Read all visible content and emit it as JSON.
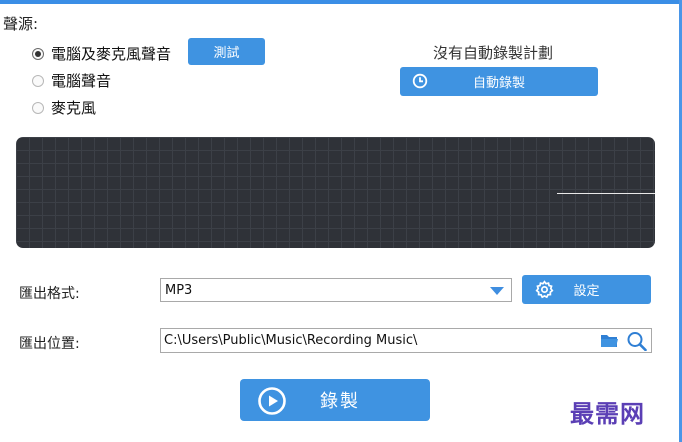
{
  "colors": {
    "accent": "#3f93e1",
    "window_border": "#3a8ee6",
    "visualizer_bg": "#2f3238",
    "visualizer_grid": "#3c4047",
    "watermark": "#5b3fb5"
  },
  "audio_source": {
    "label": "聲源:",
    "options": [
      {
        "label": "電腦及麥克風聲音",
        "selected": true
      },
      {
        "label": "電腦聲音",
        "selected": false
      },
      {
        "label": "麥克風",
        "selected": false
      }
    ],
    "test_button": "測試"
  },
  "schedule": {
    "status_text": "沒有自動錄製計劃",
    "auto_record_button": "自動錄製",
    "auto_record_icon": "clock-icon"
  },
  "visualizer": {
    "level": 0.5
  },
  "output_format": {
    "label": "匯出格式:",
    "value": "MP3",
    "settings_button": "設定",
    "settings_icon": "gear-icon"
  },
  "output_location": {
    "label": "匯出位置:",
    "value": "C:\\Users\\Public\\Music\\Recording Music\\",
    "folder_icon": "folder-icon",
    "search_icon": "search-icon"
  },
  "record_button": {
    "label": "錄製",
    "icon": "play-circle-icon"
  },
  "watermark": "最需网"
}
